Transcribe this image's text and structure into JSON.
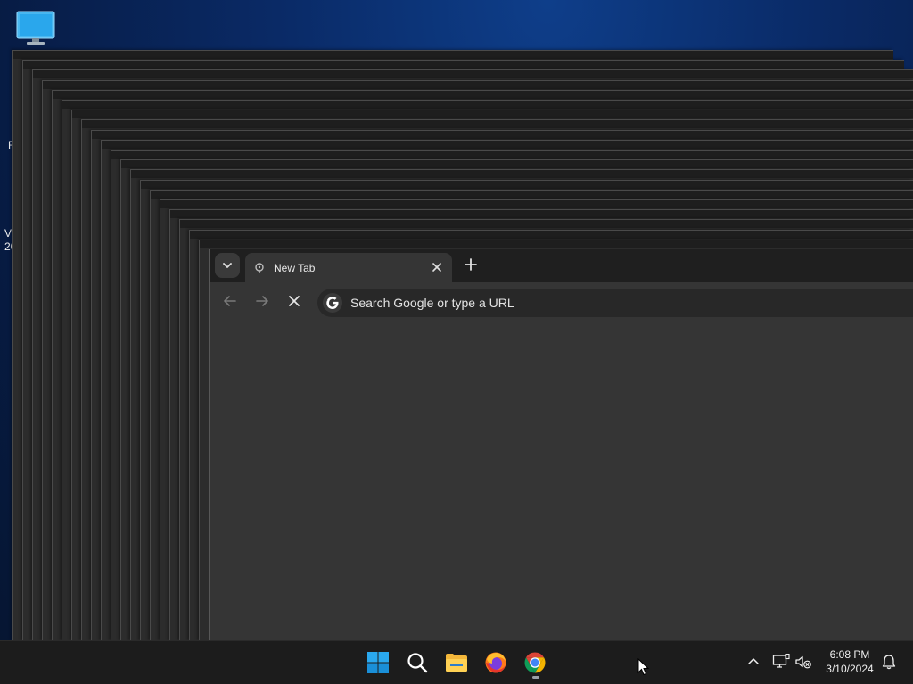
{
  "desktop": {
    "icons": [
      {
        "name": "This PC",
        "icon": "monitor-icon"
      }
    ],
    "fragments": [
      "R",
      "Vi",
      "20"
    ]
  },
  "browser": {
    "tabs": [
      {
        "title": "New Tab",
        "favicon": "loading-icon",
        "active": true
      }
    ],
    "tab_search_icon": "chevron-down-icon",
    "new_tab_icon": "plus-icon",
    "nav": {
      "back_icon": "arrow-left-icon",
      "forward_icon": "arrow-right-icon",
      "stop_icon": "close-icon"
    },
    "omnibox": {
      "placeholder": "Search Google or type a URL",
      "icon": "google-icon"
    }
  },
  "taskbar": {
    "apps": [
      {
        "name": "Start",
        "icon": "windows-logo-icon"
      },
      {
        "name": "Search",
        "icon": "search-icon"
      },
      {
        "name": "File Explorer",
        "icon": "folder-icon"
      },
      {
        "name": "Firefox",
        "icon": "firefox-icon"
      },
      {
        "name": "Chrome",
        "icon": "chrome-icon",
        "running": true
      }
    ],
    "tray": {
      "overflow_icon": "chevron-up-icon",
      "network_icon": "network-icon",
      "volume_icon": "speaker-muted-icon",
      "notification_icon": "bell-icon"
    },
    "clock": {
      "time": "6:08 PM",
      "date": "3/10/2024"
    }
  },
  "colors": {
    "accent_blue": "#0078d4",
    "chrome_red": "#db4437",
    "chrome_yellow": "#f4b400",
    "chrome_green": "#0f9d58",
    "chrome_blue": "#4285f4"
  }
}
